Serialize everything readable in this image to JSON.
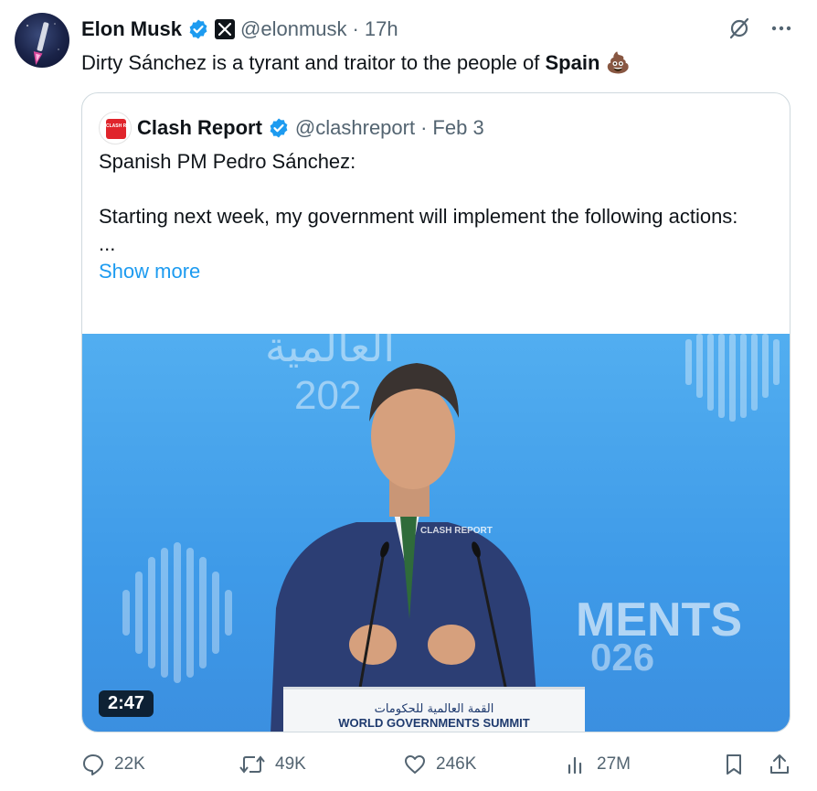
{
  "author": {
    "name": "Elon Musk",
    "handle": "@elonmusk",
    "separator": "·",
    "time": "17h",
    "verified_icon": "verified-badge-icon",
    "affiliation_icon": "x-logo-icon"
  },
  "tweet": {
    "text_before": "Dirty Sánchez is a tyrant and traitor to the people of ",
    "text_bold": "Spain",
    "emoji": "💩"
  },
  "quote": {
    "name": "Clash Report",
    "handle": "@clashreport",
    "separator": "·",
    "date": "Feb 3",
    "avatar_text": "CLASH REPORT",
    "line1": "Spanish PM Pedro Sánchez:",
    "line2": "Starting next week, my government will implement the following actions:",
    "ellipsis": "...",
    "show_more": "Show more",
    "video": {
      "duration": "2:47",
      "arabic_banner": "القمة العالمية للحكومات",
      "banner_text": "WORLD GOVERNMENTS SUMMIT",
      "bg_text_right": "MENTS",
      "bg_year_right": "026",
      "bg_year_top": "202",
      "watermark": "CLASH REPORT"
    }
  },
  "stats": {
    "replies": "22K",
    "reposts": "49K",
    "likes": "246K",
    "views": "27M"
  },
  "colors": {
    "accent": "#1d9bf0",
    "secondary_text": "#536471",
    "video_bg": "#4aa6ee"
  }
}
